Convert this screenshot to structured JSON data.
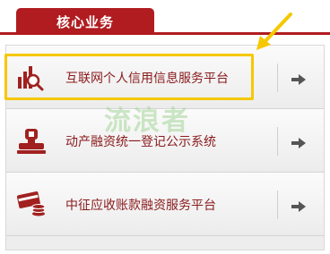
{
  "header": {
    "tab_label": "核心业务"
  },
  "items": [
    {
      "label": "互联网个人信用信息服务平台",
      "icon": "magnifier-chart-icon"
    },
    {
      "label": "动产融资统一登记公示系统",
      "icon": "stamp-icon"
    },
    {
      "label": "中征应收账款融资服务平台",
      "icon": "card-coins-icon"
    }
  ],
  "watermark": "流浪者",
  "colors": {
    "brand_red": "#b01c20",
    "label_red": "#8a1a1c",
    "highlight_yellow": "#f5c800",
    "arrow_gray": "#555555"
  }
}
